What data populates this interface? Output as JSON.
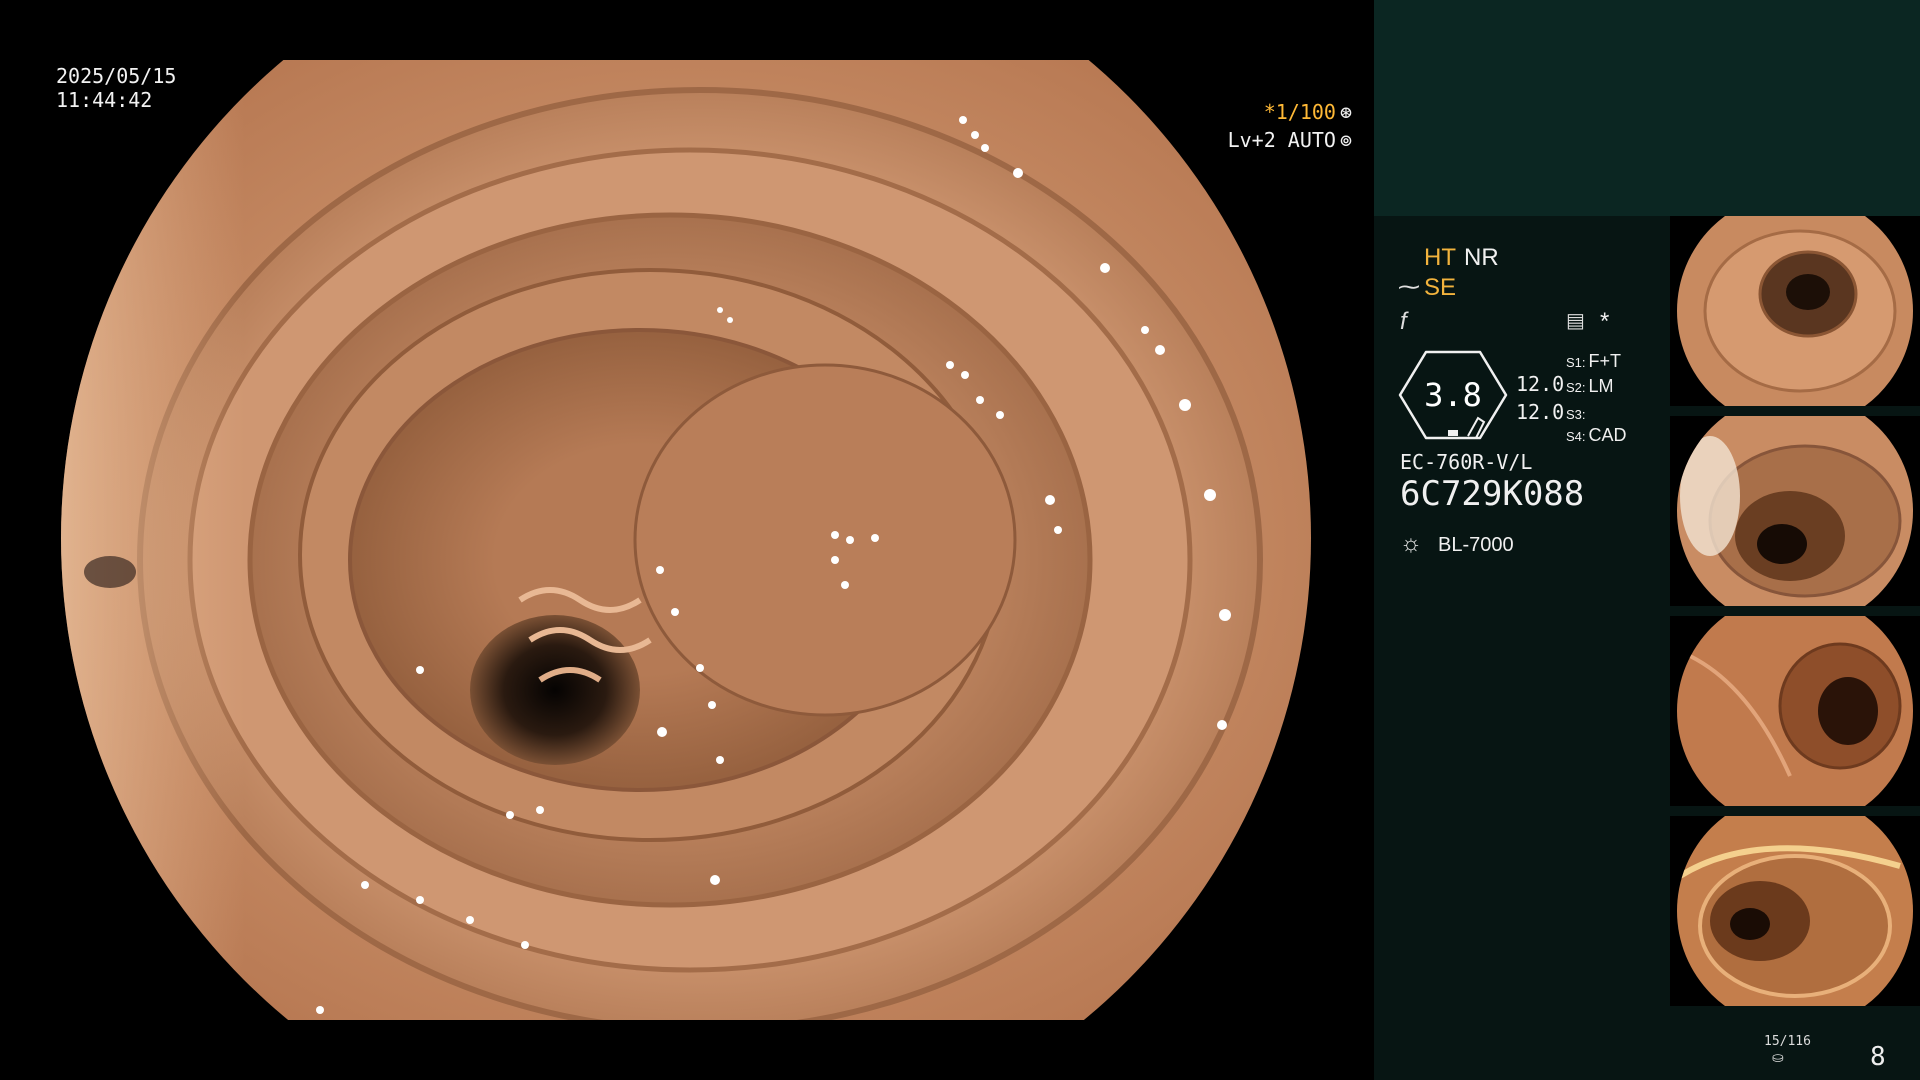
{
  "overlay": {
    "date": "2025/05/15",
    "time": "11:44:42",
    "shutter": "*1/100",
    "shutter_icon": "⊛",
    "level": "Lv+2 AUTO",
    "level_icon": "⊚"
  },
  "panel": {
    "ht": "HT",
    "nr": "NR",
    "se_icon": "⁓",
    "se": "SE",
    "f_icon": "f",
    "memo_icon": "▤",
    "star_icon": "*",
    "zoom": "3.8",
    "value1": "12.0",
    "value2": "12.0",
    "switches": [
      {
        "key": "S1:",
        "val": "F+T"
      },
      {
        "key": "S2:",
        "val": "LM"
      },
      {
        "key": "S3:",
        "val": ""
      },
      {
        "key": "S4:",
        "val": "CAD"
      }
    ],
    "scope_model": "EC-760R-V/L",
    "scope_serial": "6C729K088",
    "lamp_icon": "☼",
    "lamp": "BL-7000",
    "counter": "15/116",
    "disk_icon": "⛀",
    "page": "8"
  },
  "colors": {
    "panel_bg": "#071513",
    "panel_top": "#0b2622",
    "accent": "#f2b33d"
  }
}
